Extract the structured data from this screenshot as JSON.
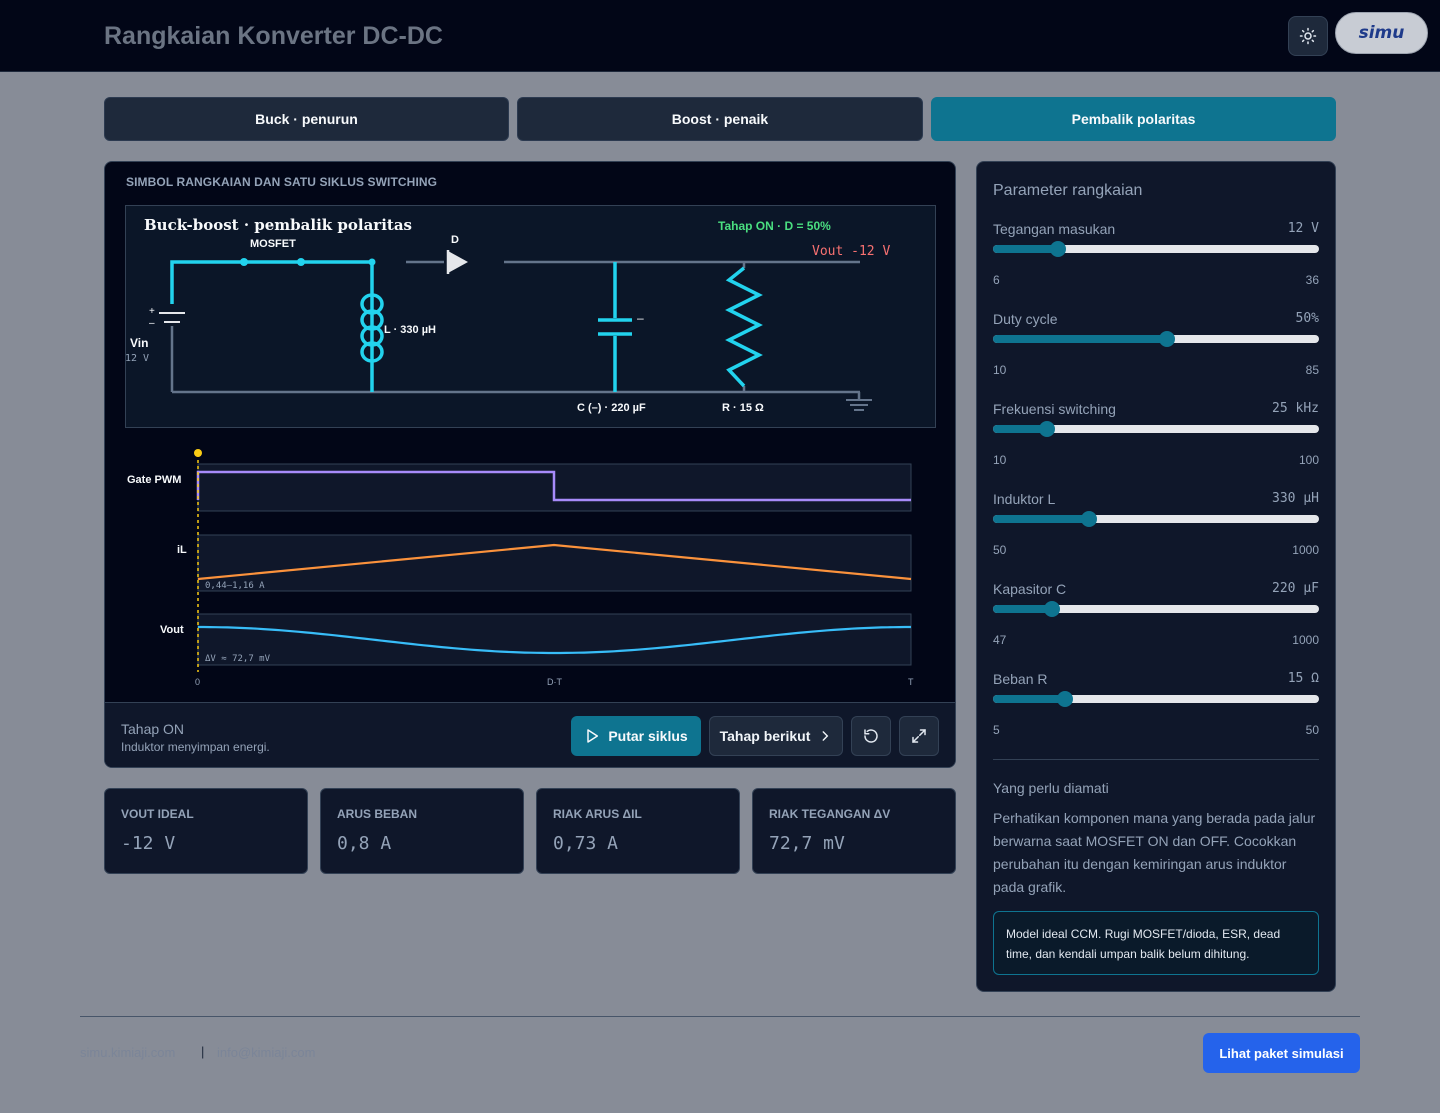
{
  "header": {
    "title": "Rangkaian Konverter DC-DC",
    "logo_text": "simu"
  },
  "tabs": [
    {
      "label": "Buck · penurun"
    },
    {
      "label": "Boost · penaik"
    },
    {
      "label": "Pembalik polaritas"
    }
  ],
  "circuit": {
    "caption": "SIMBOL RANGKAIAN DAN SATU SIKLUS SWITCHING",
    "title": "Buck-boost · pembalik polaritas",
    "stage_badge": "Tahap ON · D = 50%",
    "vout_label": "Vout -12 V",
    "mosfet_label": "MOSFET",
    "diode_label": "D",
    "inductor_label": "L · 330 µH",
    "capacitor_label": "C (–) · 220 µF",
    "capacitor_sign": "–",
    "resistor_label": "R · 15 Ω",
    "vin_label": "Vin",
    "vin_value": "12 V",
    "battery_plus": "+",
    "battery_minus": "–"
  },
  "waveforms": {
    "gate_label": "Gate PWM",
    "il_label": "iL",
    "il_range": "0,44–1,16 A",
    "vout_label": "Vout",
    "vout_ripple": "ΔV ≈ 72,7 mV",
    "axis_0": "0",
    "axis_dt": "D·T",
    "axis_t": "T"
  },
  "stage": {
    "title": "Tahap ON",
    "desc": "Induktor menyimpan energi."
  },
  "controls": {
    "play": "Putar siklus",
    "next": "Tahap berikut"
  },
  "stats": [
    {
      "label": "VOUT IDEAL",
      "value": "-12 V"
    },
    {
      "label": "ARUS BEBAN",
      "value": "0,8 A"
    },
    {
      "label": "RIAK ARUS ΔIL",
      "value": "0,73 A"
    },
    {
      "label": "RIAK TEGANGAN ΔV",
      "value": "72,7 mV"
    }
  ],
  "params": {
    "heading": "Parameter rangkaian",
    "items": [
      {
        "label": "Tegangan masukan",
        "value": "12 V",
        "min": "6",
        "max": "36",
        "level": 0.2
      },
      {
        "label": "Duty cycle",
        "value": "50%",
        "min": "10",
        "max": "85",
        "level": 0.533
      },
      {
        "label": "Frekuensi switching",
        "value": "25 kHz",
        "min": "10",
        "max": "100",
        "level": 0.167
      },
      {
        "label": "Induktor L",
        "value": "330 µH",
        "min": "50",
        "max": "1000",
        "level": 0.295
      },
      {
        "label": "Kapasitor C",
        "value": "220 µF",
        "min": "47",
        "max": "1000",
        "level": 0.182
      },
      {
        "label": "Beban R",
        "value": "15 Ω",
        "min": "5",
        "max": "50",
        "level": 0.222
      }
    ],
    "note_title": "Yang perlu diamati",
    "note_body": "Perhatikan komponen mana yang berada pada jalur berwarna saat MOSFET ON dan OFF. Cocokkan perubahan itu dengan kemiringan arus induktor pada grafik.",
    "model_note": "Model ideal CCM. Rugi MOSFET/dioda, ESR, dead time, dan kendali umpan balik belum dihitung."
  },
  "footer": {
    "link1": "simu.kimiaji.com",
    "separator": "|",
    "link2": "info@kimiaji.com",
    "cta": "Lihat paket simulasi"
  },
  "colors": {
    "accent": "#0e7490",
    "active_path": "#22d3ee",
    "gate_wave": "#a78bfa",
    "il_wave": "#fb923c",
    "vout_wave": "#38bdf8",
    "on_badge": "#4ade80",
    "vout_text": "#f87171",
    "cta": "#2563eb"
  }
}
